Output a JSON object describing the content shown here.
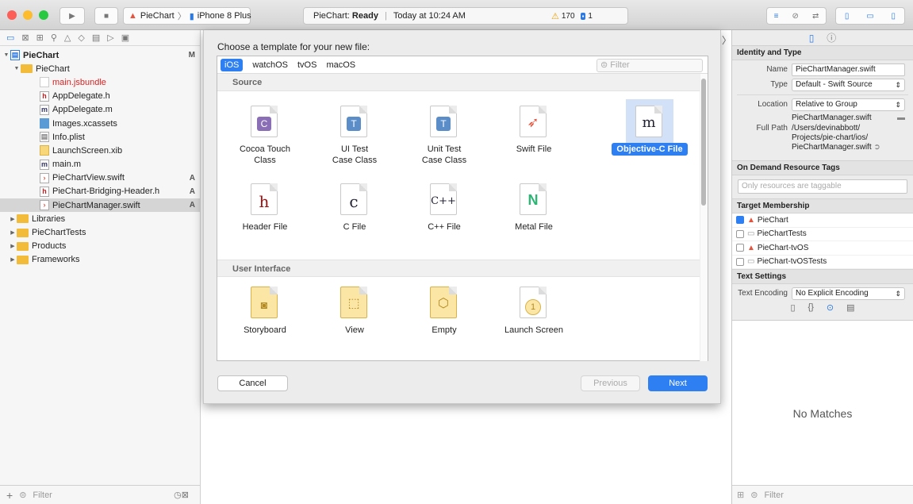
{
  "toolbar": {
    "scheme": "PieChart",
    "device": "iPhone 8 Plus",
    "status_app": "PieChart:",
    "status_state": "Ready",
    "status_time": "Today at 10:24 AM",
    "warnings": "170",
    "issues": "1"
  },
  "navigator": {
    "project": "PieChart",
    "project_badge": "M",
    "group": "PieChart",
    "files": [
      {
        "name": "main.jsbundle",
        "badge": ""
      },
      {
        "name": "AppDelegate.h",
        "badge": ""
      },
      {
        "name": "AppDelegate.m",
        "badge": ""
      },
      {
        "name": "Images.xcassets",
        "badge": ""
      },
      {
        "name": "Info.plist",
        "badge": ""
      },
      {
        "name": "LaunchScreen.xib",
        "badge": ""
      },
      {
        "name": "main.m",
        "badge": ""
      },
      {
        "name": "PieChartView.swift",
        "badge": "A"
      },
      {
        "name": "PieChart-Bridging-Header.h",
        "badge": "A"
      },
      {
        "name": "PieChartManager.swift",
        "badge": "A"
      }
    ],
    "folders": [
      "Libraries",
      "PieChartTests",
      "Products",
      "Frameworks"
    ],
    "filter_placeholder": "Filter"
  },
  "sheet": {
    "title": "Choose a template for your new file:",
    "tabs": [
      "iOS",
      "watchOS",
      "tvOS",
      "macOS"
    ],
    "filter_placeholder": "Filter",
    "section_source": "Source",
    "source_items": [
      {
        "line1": "Cocoa Touch",
        "line2": "Class"
      },
      {
        "line1": "UI Test",
        "line2": "Case Class"
      },
      {
        "line1": "Unit Test",
        "line2": "Case Class"
      },
      {
        "line1": "Swift File",
        "line2": ""
      },
      {
        "line1": "Objective-C File",
        "line2": ""
      },
      {
        "line1": "Header File",
        "line2": ""
      },
      {
        "line1": "C File",
        "line2": ""
      },
      {
        "line1": "C++ File",
        "line2": ""
      },
      {
        "line1": "Metal File",
        "line2": ""
      }
    ],
    "section_ui": "User Interface",
    "ui_items": [
      "Storyboard",
      "View",
      "Empty",
      "Launch Screen"
    ],
    "cancel": "Cancel",
    "previous": "Previous",
    "next": "Next"
  },
  "inspector": {
    "identity_title": "Identity and Type",
    "name_label": "Name",
    "name_value": "PieChartManager.swift",
    "type_label": "Type",
    "type_value": "Default - Swift Source",
    "location_label": "Location",
    "location_value": "Relative to Group",
    "location_file": "PieChartManager.swift",
    "fullpath_label": "Full Path",
    "fullpath_lines": [
      "/Users/devinabbott/",
      "Projects/pie-chart/ios/",
      "PieChartManager.swift"
    ],
    "ondemand_title": "On Demand Resource Tags",
    "ondemand_placeholder": "Only resources are taggable",
    "target_title": "Target Membership",
    "targets": [
      {
        "name": "PieChart",
        "checked": true
      },
      {
        "name": "PieChartTests",
        "checked": false
      },
      {
        "name": "PieChart-tvOS",
        "checked": false
      },
      {
        "name": "PieChart-tvOSTests",
        "checked": false
      }
    ],
    "text_title": "Text Settings",
    "encoding_label": "Text Encoding",
    "encoding_value": "No Explicit Encoding",
    "no_matches": "No Matches",
    "filter_placeholder": "Filter"
  }
}
